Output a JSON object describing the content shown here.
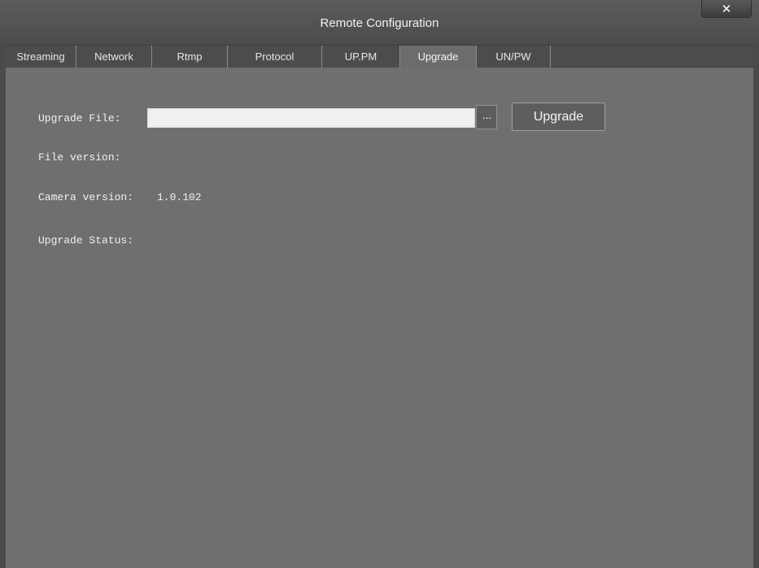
{
  "window": {
    "title": "Remote Configuration",
    "close_icon": "close-icon",
    "close_glyph": "✕"
  },
  "tabs": [
    {
      "label": "Streaming"
    },
    {
      "label": "Network"
    },
    {
      "label": "Rtmp"
    },
    {
      "label": "Protocol"
    },
    {
      "label": "UP.PM"
    },
    {
      "label": "Upgrade",
      "active": true
    },
    {
      "label": "UN/PW"
    }
  ],
  "upgrade": {
    "file_label": "Upgrade File:",
    "file_value": "",
    "browse_label": "···",
    "button_label": "Upgrade",
    "file_version_label": "File version:",
    "file_version_value": "",
    "camera_version_label": "Camera version:",
    "camera_version_value": "1.0.102",
    "status_label": "Upgrade Status:",
    "status_value": ""
  }
}
